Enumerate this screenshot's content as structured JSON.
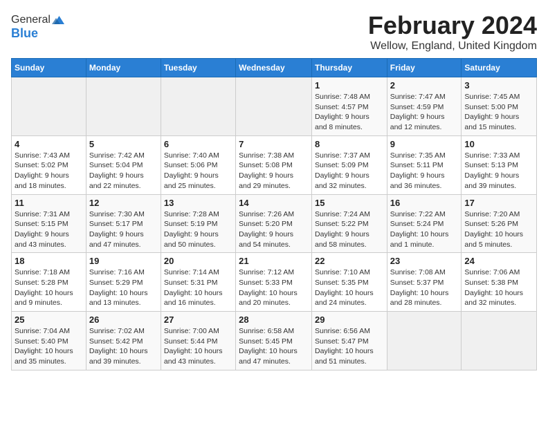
{
  "header": {
    "logo_general": "General",
    "logo_blue": "Blue",
    "month_year": "February 2024",
    "location": "Wellow, England, United Kingdom"
  },
  "weekdays": [
    "Sunday",
    "Monday",
    "Tuesday",
    "Wednesday",
    "Thursday",
    "Friday",
    "Saturday"
  ],
  "weeks": [
    [
      {
        "day": "",
        "info": ""
      },
      {
        "day": "",
        "info": ""
      },
      {
        "day": "",
        "info": ""
      },
      {
        "day": "",
        "info": ""
      },
      {
        "day": "1",
        "info": "Sunrise: 7:48 AM\nSunset: 4:57 PM\nDaylight: 9 hours\nand 8 minutes."
      },
      {
        "day": "2",
        "info": "Sunrise: 7:47 AM\nSunset: 4:59 PM\nDaylight: 9 hours\nand 12 minutes."
      },
      {
        "day": "3",
        "info": "Sunrise: 7:45 AM\nSunset: 5:00 PM\nDaylight: 9 hours\nand 15 minutes."
      }
    ],
    [
      {
        "day": "4",
        "info": "Sunrise: 7:43 AM\nSunset: 5:02 PM\nDaylight: 9 hours\nand 18 minutes."
      },
      {
        "day": "5",
        "info": "Sunrise: 7:42 AM\nSunset: 5:04 PM\nDaylight: 9 hours\nand 22 minutes."
      },
      {
        "day": "6",
        "info": "Sunrise: 7:40 AM\nSunset: 5:06 PM\nDaylight: 9 hours\nand 25 minutes."
      },
      {
        "day": "7",
        "info": "Sunrise: 7:38 AM\nSunset: 5:08 PM\nDaylight: 9 hours\nand 29 minutes."
      },
      {
        "day": "8",
        "info": "Sunrise: 7:37 AM\nSunset: 5:09 PM\nDaylight: 9 hours\nand 32 minutes."
      },
      {
        "day": "9",
        "info": "Sunrise: 7:35 AM\nSunset: 5:11 PM\nDaylight: 9 hours\nand 36 minutes."
      },
      {
        "day": "10",
        "info": "Sunrise: 7:33 AM\nSunset: 5:13 PM\nDaylight: 9 hours\nand 39 minutes."
      }
    ],
    [
      {
        "day": "11",
        "info": "Sunrise: 7:31 AM\nSunset: 5:15 PM\nDaylight: 9 hours\nand 43 minutes."
      },
      {
        "day": "12",
        "info": "Sunrise: 7:30 AM\nSunset: 5:17 PM\nDaylight: 9 hours\nand 47 minutes."
      },
      {
        "day": "13",
        "info": "Sunrise: 7:28 AM\nSunset: 5:19 PM\nDaylight: 9 hours\nand 50 minutes."
      },
      {
        "day": "14",
        "info": "Sunrise: 7:26 AM\nSunset: 5:20 PM\nDaylight: 9 hours\nand 54 minutes."
      },
      {
        "day": "15",
        "info": "Sunrise: 7:24 AM\nSunset: 5:22 PM\nDaylight: 9 hours\nand 58 minutes."
      },
      {
        "day": "16",
        "info": "Sunrise: 7:22 AM\nSunset: 5:24 PM\nDaylight: 10 hours\nand 1 minute."
      },
      {
        "day": "17",
        "info": "Sunrise: 7:20 AM\nSunset: 5:26 PM\nDaylight: 10 hours\nand 5 minutes."
      }
    ],
    [
      {
        "day": "18",
        "info": "Sunrise: 7:18 AM\nSunset: 5:28 PM\nDaylight: 10 hours\nand 9 minutes."
      },
      {
        "day": "19",
        "info": "Sunrise: 7:16 AM\nSunset: 5:29 PM\nDaylight: 10 hours\nand 13 minutes."
      },
      {
        "day": "20",
        "info": "Sunrise: 7:14 AM\nSunset: 5:31 PM\nDaylight: 10 hours\nand 16 minutes."
      },
      {
        "day": "21",
        "info": "Sunrise: 7:12 AM\nSunset: 5:33 PM\nDaylight: 10 hours\nand 20 minutes."
      },
      {
        "day": "22",
        "info": "Sunrise: 7:10 AM\nSunset: 5:35 PM\nDaylight: 10 hours\nand 24 minutes."
      },
      {
        "day": "23",
        "info": "Sunrise: 7:08 AM\nSunset: 5:37 PM\nDaylight: 10 hours\nand 28 minutes."
      },
      {
        "day": "24",
        "info": "Sunrise: 7:06 AM\nSunset: 5:38 PM\nDaylight: 10 hours\nand 32 minutes."
      }
    ],
    [
      {
        "day": "25",
        "info": "Sunrise: 7:04 AM\nSunset: 5:40 PM\nDaylight: 10 hours\nand 35 minutes."
      },
      {
        "day": "26",
        "info": "Sunrise: 7:02 AM\nSunset: 5:42 PM\nDaylight: 10 hours\nand 39 minutes."
      },
      {
        "day": "27",
        "info": "Sunrise: 7:00 AM\nSunset: 5:44 PM\nDaylight: 10 hours\nand 43 minutes."
      },
      {
        "day": "28",
        "info": "Sunrise: 6:58 AM\nSunset: 5:45 PM\nDaylight: 10 hours\nand 47 minutes."
      },
      {
        "day": "29",
        "info": "Sunrise: 6:56 AM\nSunset: 5:47 PM\nDaylight: 10 hours\nand 51 minutes."
      },
      {
        "day": "",
        "info": ""
      },
      {
        "day": "",
        "info": ""
      }
    ]
  ]
}
